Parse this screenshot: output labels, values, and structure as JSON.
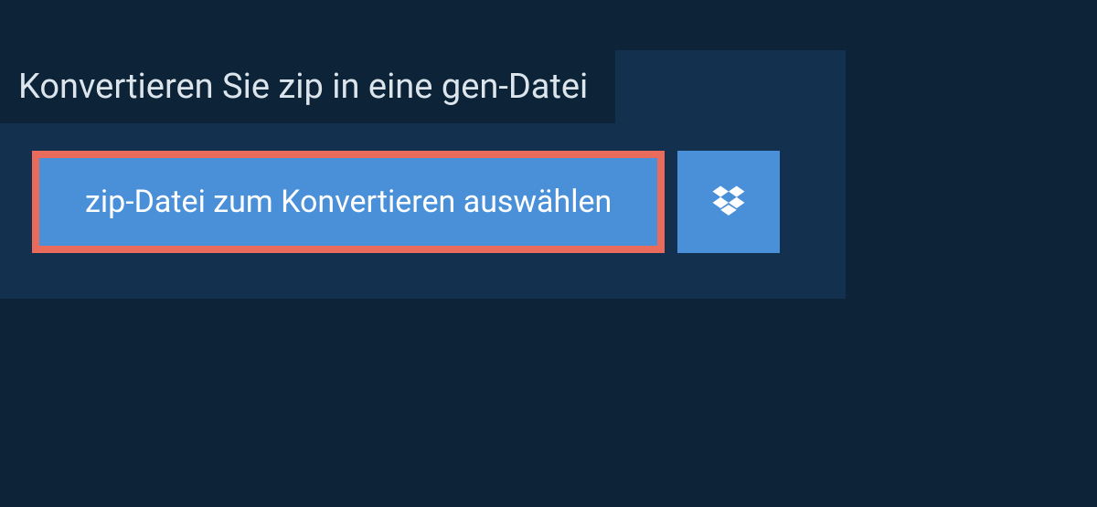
{
  "header": {
    "title": "Konvertieren Sie zip in eine gen-Datei"
  },
  "actions": {
    "select_file_label": "zip-Datei zum Konvertieren auswählen"
  },
  "colors": {
    "page_bg": "#0d2438",
    "panel_bg": "#13314f",
    "button_bg": "#4a90d9",
    "button_border_highlight": "#e86b5c",
    "text_light": "#ffffff"
  }
}
